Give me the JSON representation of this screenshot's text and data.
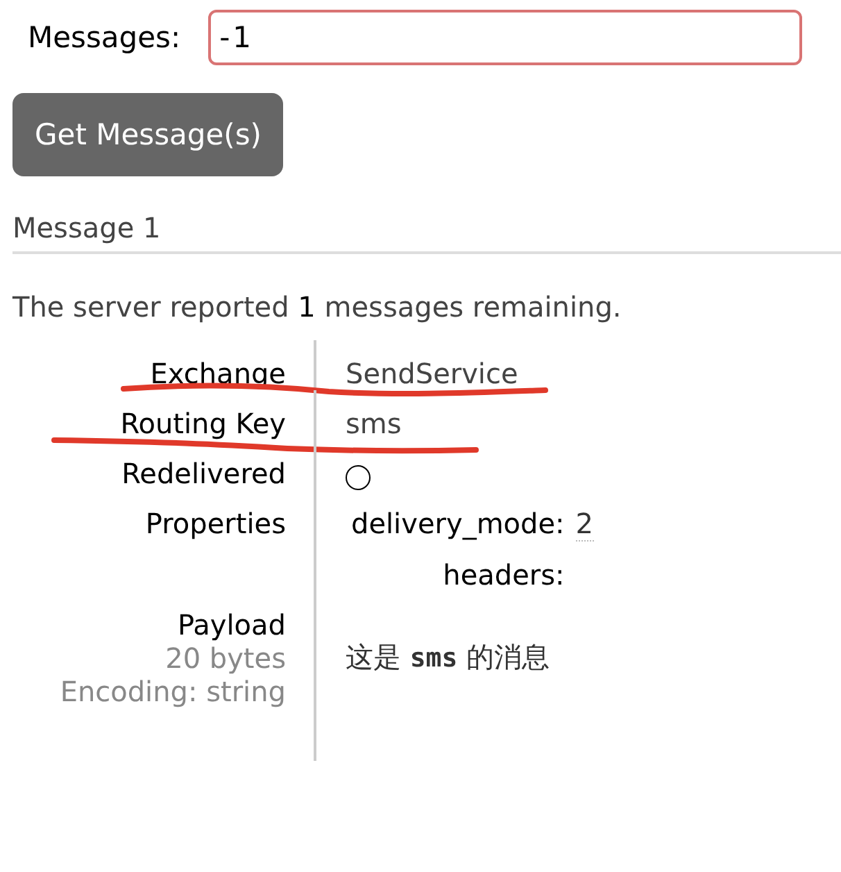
{
  "form": {
    "label": "Messages:",
    "value": "-1",
    "invalid": true,
    "button": "Get Message(s)"
  },
  "message": {
    "heading": "Message 1",
    "summary": "The server reported **1** messages remaining.",
    "rows": [
      {
        "kind": "text",
        "label": "Exchange",
        "value": "SendService",
        "underlined": true
      },
      {
        "kind": "text",
        "label": "Routing Key",
        "value": "sms",
        "underlined": true
      },
      {
        "kind": "flag",
        "label": "Redelivered",
        "checked": false,
        "underlined": false
      },
      {
        "kind": "props",
        "label": "Properties",
        "underlined": false,
        "props": [
          {
            "key": "delivery_mode:",
            "value": "2"
          },
          {
            "key": "headers:"
          }
        ]
      },
      {
        "kind": "payload",
        "label": "Payload",
        "notes": [
          "20 bytes",
          "Encoding: string"
        ],
        "value": "这是 **sms** 的消息",
        "underlined": false
      }
    ]
  }
}
